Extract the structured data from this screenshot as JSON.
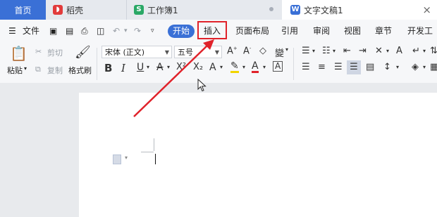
{
  "tabs": {
    "home": "首页",
    "daoke": "稻壳",
    "workbook": "工作簿1",
    "document": "文字文稿1"
  },
  "menubar": {
    "file": "文件",
    "start": "开始",
    "insert": "插入",
    "layout": "页面布局",
    "reference": "引用",
    "review": "审阅",
    "view": "视图",
    "section": "章节",
    "developer": "开发工具"
  },
  "ribbon": {
    "paste": "粘贴",
    "cut": "剪切",
    "copy": "复制",
    "format_painter": "格式刷",
    "font_name": "宋体 (正文)",
    "font_size": "五号"
  },
  "colors": {
    "accent": "#3a70d6",
    "highlight_box": "#e0222a"
  }
}
